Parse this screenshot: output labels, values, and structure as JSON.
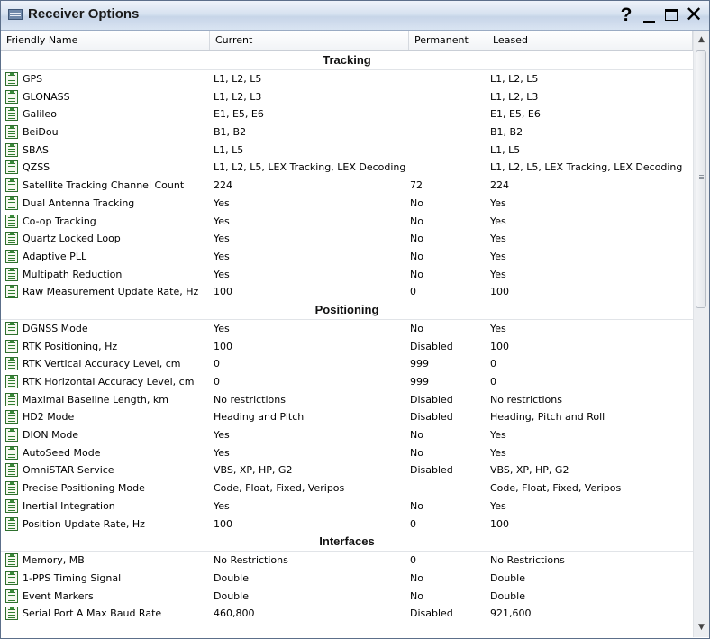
{
  "window": {
    "title": "Receiver Options",
    "help_label": "?",
    "close_label": "✕"
  },
  "columns": {
    "friendly_name": "Friendly Name",
    "current": "Current",
    "permanent": "Permanent",
    "leased": "Leased"
  },
  "sections": {
    "tracking": {
      "label": "Tracking",
      "rows": [
        {
          "name": "GPS",
          "current": "L1, L2, L5",
          "permanent": "",
          "leased": "L1, L2, L5"
        },
        {
          "name": "GLONASS",
          "current": "L1, L2, L3",
          "permanent": "",
          "leased": "L1, L2, L3"
        },
        {
          "name": "Galileo",
          "current": "E1, E5, E6",
          "permanent": "",
          "leased": "E1, E5, E6"
        },
        {
          "name": "BeiDou",
          "current": "B1, B2",
          "permanent": "",
          "leased": "B1, B2"
        },
        {
          "name": "SBAS",
          "current": "L1, L5",
          "permanent": "",
          "leased": "L1, L5"
        },
        {
          "name": "QZSS",
          "current": "L1, L2, L5, LEX Tracking, LEX Decoding",
          "permanent": "",
          "leased": "L1, L2, L5, LEX Tracking, LEX Decoding"
        },
        {
          "name": "Satellite Tracking Channel Count",
          "current": "224",
          "permanent": "72",
          "leased": "224"
        },
        {
          "name": "Dual Antenna Tracking",
          "current": "Yes",
          "permanent": "No",
          "leased": "Yes"
        },
        {
          "name": "Co-op Tracking",
          "current": "Yes",
          "permanent": "No",
          "leased": "Yes"
        },
        {
          "name": "Quartz Locked Loop",
          "current": "Yes",
          "permanent": "No",
          "leased": "Yes"
        },
        {
          "name": "Adaptive PLL",
          "current": "Yes",
          "permanent": "No",
          "leased": "Yes"
        },
        {
          "name": "Multipath Reduction",
          "current": "Yes",
          "permanent": "No",
          "leased": "Yes"
        },
        {
          "name": "Raw Measurement Update Rate, Hz",
          "current": "100",
          "permanent": "0",
          "leased": "100"
        }
      ]
    },
    "positioning": {
      "label": "Positioning",
      "rows": [
        {
          "name": "DGNSS Mode",
          "current": "Yes",
          "permanent": "No",
          "leased": "Yes"
        },
        {
          "name": "RTK Positioning, Hz",
          "current": "100",
          "permanent": "Disabled",
          "leased": "100"
        },
        {
          "name": "RTK Vertical Accuracy Level, cm",
          "current": "0",
          "permanent": "999",
          "leased": "0"
        },
        {
          "name": "RTK Horizontal Accuracy Level, cm",
          "current": "0",
          "permanent": "999",
          "leased": "0"
        },
        {
          "name": "Maximal Baseline Length, km",
          "current": "No restrictions",
          "permanent": "Disabled",
          "leased": "No restrictions"
        },
        {
          "name": "HD2 Mode",
          "current": "Heading and Pitch",
          "permanent": "Disabled",
          "leased": "Heading, Pitch and Roll"
        },
        {
          "name": "DION Mode",
          "current": "Yes",
          "permanent": "No",
          "leased": "Yes"
        },
        {
          "name": "AutoSeed Mode",
          "current": "Yes",
          "permanent": "No",
          "leased": "Yes"
        },
        {
          "name": "OmniSTAR Service",
          "current": "VBS, XP, HP, G2",
          "permanent": "Disabled",
          "leased": "VBS, XP, HP, G2"
        },
        {
          "name": "Precise Positioning Mode",
          "current": "Code, Float, Fixed, Veripos",
          "permanent": "",
          "leased": "Code, Float, Fixed, Veripos"
        },
        {
          "name": "Inertial Integration",
          "current": "Yes",
          "permanent": "No",
          "leased": "Yes"
        },
        {
          "name": "Position Update Rate, Hz",
          "current": "100",
          "permanent": "0",
          "leased": "100"
        }
      ]
    },
    "interfaces": {
      "label": "Interfaces",
      "rows": [
        {
          "name": "Memory, MB",
          "current": "No Restrictions",
          "permanent": "0",
          "leased": "No Restrictions"
        },
        {
          "name": "1-PPS Timing Signal",
          "current": "Double",
          "permanent": "No",
          "leased": "Double"
        },
        {
          "name": "Event Markers",
          "current": "Double",
          "permanent": "No",
          "leased": "Double"
        },
        {
          "name": "Serial Port A Max Baud Rate",
          "current": "460,800",
          "permanent": "Disabled",
          "leased": "921,600"
        }
      ]
    }
  },
  "scrollbar": {
    "up_glyph": "▲",
    "down_glyph": "▼"
  }
}
